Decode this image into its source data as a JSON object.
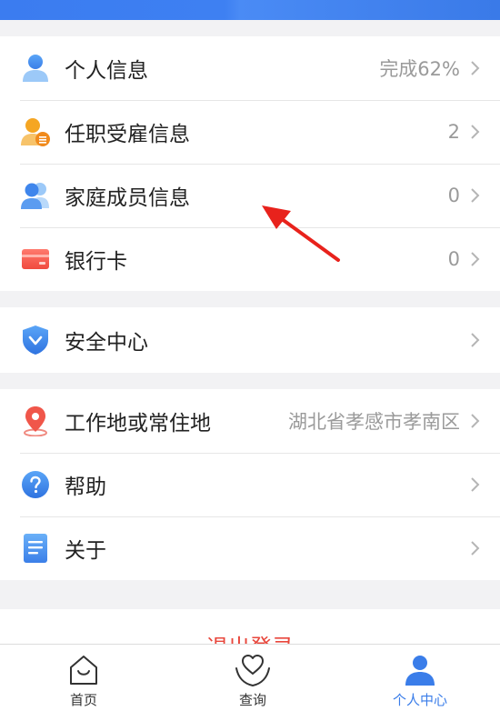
{
  "colors": {
    "accent": "#3a7de9",
    "logout": "#e8473c",
    "arrow": "#e8221c"
  },
  "group1": [
    {
      "label": "个人信息",
      "value": "完成62%",
      "icon": "user-icon"
    },
    {
      "label": "任职受雇信息",
      "value": "2",
      "icon": "employee-icon"
    },
    {
      "label": "家庭成员信息",
      "value": "0",
      "icon": "family-icon"
    },
    {
      "label": "银行卡",
      "value": "0",
      "icon": "bank-card-icon"
    }
  ],
  "group2": [
    {
      "label": "安全中心",
      "value": "",
      "icon": "shield-icon"
    }
  ],
  "group3": [
    {
      "label": "工作地或常住地",
      "value": "湖北省孝感市孝南区",
      "icon": "location-pin-icon"
    },
    {
      "label": "帮助",
      "value": "",
      "icon": "help-icon"
    },
    {
      "label": "关于",
      "value": "",
      "icon": "document-icon"
    }
  ],
  "logout_label": "退出登录",
  "tabs": [
    {
      "label": "首页",
      "icon": "home-icon",
      "active": false
    },
    {
      "label": "查询",
      "icon": "query-heart-icon",
      "active": false
    },
    {
      "label": "个人中心",
      "icon": "person-icon",
      "active": true
    }
  ]
}
